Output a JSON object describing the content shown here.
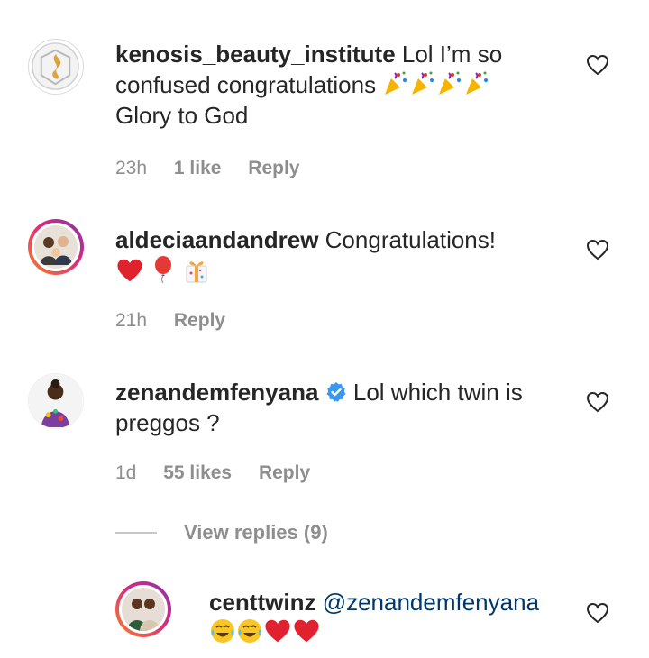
{
  "comments": [
    {
      "username": "kenosis_beauty_institute",
      "text_line1": "Lol I’m so",
      "text_line2": "confused congratulations",
      "text_line3": "Glory to God",
      "emoji_line2": [
        "party-popper",
        "party-popper",
        "party-popper",
        "party-popper"
      ],
      "time": "23h",
      "likes": "1 like",
      "reply": "Reply"
    },
    {
      "username": "aldeciaandandrew",
      "text_line1": "Congratulations!",
      "emojis": [
        "red-heart",
        "balloon",
        "gift"
      ],
      "time": "21h",
      "reply": "Reply"
    },
    {
      "username": "zenandemfenyana",
      "verified": true,
      "text_line1": "Lol which twin is",
      "text_line2": "preggos ?",
      "time": "1d",
      "likes": "55 likes",
      "reply": "Reply"
    }
  ],
  "view_replies": "View replies (9)",
  "reply": {
    "username": "centtwinz",
    "mention": "@zenandemfenyana",
    "emojis": [
      "tears-of-joy",
      "tears-of-joy",
      "red-heart",
      "red-heart"
    ]
  },
  "colors": {
    "text": "#262626",
    "secondary": "#8e8e8e",
    "link": "#00376b",
    "verified": "#3897f0"
  }
}
